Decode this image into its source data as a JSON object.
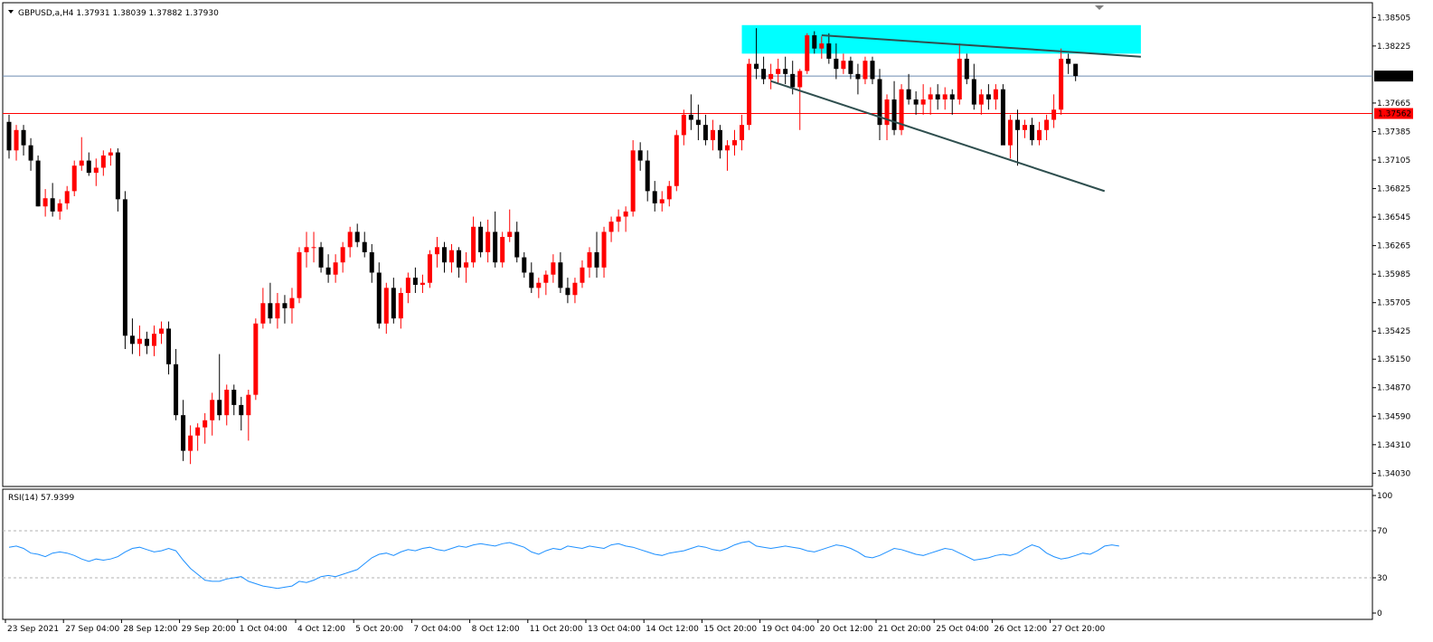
{
  "chart_data": [
    {
      "type": "candlestick",
      "symbol_header": "GBPUSD,a,H4  1.37931 1.38039 1.37882 1.37930",
      "ylim": [
        1.339,
        1.3865
      ],
      "y_ticks": [
        "1.38505",
        "1.38225",
        "1.37665",
        "1.37385",
        "1.37105",
        "1.36825",
        "1.36545",
        "1.36265",
        "1.35985",
        "1.35705",
        "1.35425",
        "1.35150",
        "1.34870",
        "1.34590",
        "1.34310",
        "1.34030"
      ],
      "y_tick_values": [
        1.38505,
        1.38225,
        1.37665,
        1.37385,
        1.37105,
        1.36825,
        1.36545,
        1.36265,
        1.35985,
        1.35705,
        1.35425,
        1.3515,
        1.3487,
        1.3459,
        1.3431,
        1.3403
      ],
      "x_ticks": [
        "23 Sep 2021",
        "27 Sep 04:00",
        "28 Sep 12:00",
        "29 Sep 20:00",
        "1 Oct 04:00",
        "4 Oct 12:00",
        "5 Oct 20:00",
        "7 Oct 04:00",
        "8 Oct 12:00",
        "11 Oct 20:00",
        "13 Oct 04:00",
        "14 Oct 12:00",
        "15 Oct 20:00",
        "19 Oct 04:00",
        "20 Oct 12:00",
        "21 Oct 20:00",
        "25 Oct 04:00",
        "26 Oct 12:00",
        "27 Oct 20:00"
      ],
      "x_tick_bar_index": [
        0,
        8,
        16,
        24,
        32,
        40,
        48,
        56,
        64,
        72,
        80,
        88,
        96,
        104,
        112,
        120,
        128,
        136,
        144
      ],
      "current_price": {
        "label": "1.37930",
        "value": 1.3793
      },
      "support_line": {
        "label": "1.37562",
        "value": 1.37562
      },
      "resistance_zone": {
        "from_bar": 101,
        "to_bar": 156,
        "low": 1.3815,
        "high": 1.3843
      },
      "trendlines": [
        {
          "from_bar": 112,
          "from_value": 1.3833,
          "to_bar": 156,
          "to_value": 1.3812
        },
        {
          "from_bar": 105,
          "from_value": 1.3788,
          "to_bar": 151,
          "to_value": 1.368
        }
      ],
      "candles": [
        [
          1.3748,
          1.3755,
          1.3712,
          1.372
        ],
        [
          1.372,
          1.3745,
          1.371,
          1.374
        ],
        [
          1.374,
          1.3745,
          1.3715,
          1.3725
        ],
        [
          1.3725,
          1.3732,
          1.37,
          1.371
        ],
        [
          1.371,
          1.3715,
          1.3665,
          1.3665
        ],
        [
          1.3665,
          1.3682,
          1.3655,
          1.3673
        ],
        [
          1.3673,
          1.3688,
          1.3655,
          1.366
        ],
        [
          1.366,
          1.3672,
          1.3652,
          1.3668
        ],
        [
          1.3668,
          1.3685,
          1.3662,
          1.368
        ],
        [
          1.368,
          1.371,
          1.3675,
          1.3705
        ],
        [
          1.3705,
          1.3733,
          1.37,
          1.371
        ],
        [
          1.371,
          1.3718,
          1.3695,
          1.3698
        ],
        [
          1.3698,
          1.3712,
          1.3685,
          1.3703
        ],
        [
          1.3703,
          1.372,
          1.3695,
          1.3715
        ],
        [
          1.3715,
          1.3722,
          1.3705,
          1.3718
        ],
        [
          1.3718,
          1.3722,
          1.366,
          1.3672
        ],
        [
          1.3672,
          1.368,
          1.3525,
          1.3538
        ],
        [
          1.3538,
          1.3555,
          1.352,
          1.353
        ],
        [
          1.353,
          1.3548,
          1.3518,
          1.3535
        ],
        [
          1.3535,
          1.3542,
          1.352,
          1.3528
        ],
        [
          1.3528,
          1.3548,
          1.3518,
          1.354
        ],
        [
          1.354,
          1.3552,
          1.353,
          1.3545
        ],
        [
          1.3545,
          1.3552,
          1.35,
          1.351
        ],
        [
          1.351,
          1.3525,
          1.3455,
          1.346
        ],
        [
          1.346,
          1.3475,
          1.3415,
          1.3425
        ],
        [
          1.3425,
          1.345,
          1.3412,
          1.344
        ],
        [
          1.344,
          1.3452,
          1.3425,
          1.3448
        ],
        [
          1.3448,
          1.3462,
          1.3432,
          1.3455
        ],
        [
          1.3455,
          1.3482,
          1.344,
          1.3475
        ],
        [
          1.3475,
          1.352,
          1.3455,
          1.346
        ],
        [
          1.346,
          1.349,
          1.345,
          1.3485
        ],
        [
          1.3485,
          1.349,
          1.346,
          1.347
        ],
        [
          1.347,
          1.3478,
          1.3445,
          1.346
        ],
        [
          1.346,
          1.3485,
          1.3435,
          1.348
        ],
        [
          1.348,
          1.3555,
          1.3475,
          1.355
        ],
        [
          1.355,
          1.3585,
          1.3545,
          1.357
        ],
        [
          1.357,
          1.359,
          1.355,
          1.3555
        ],
        [
          1.3555,
          1.358,
          1.3545,
          1.357
        ],
        [
          1.357,
          1.3578,
          1.355,
          1.3565
        ],
        [
          1.3565,
          1.3585,
          1.355,
          1.3575
        ],
        [
          1.3575,
          1.3625,
          1.357,
          1.362
        ],
        [
          1.362,
          1.364,
          1.3605,
          1.3625
        ],
        [
          1.3625,
          1.364,
          1.361,
          1.3625
        ],
        [
          1.3625,
          1.363,
          1.36,
          1.3605
        ],
        [
          1.3605,
          1.3618,
          1.359,
          1.3598
        ],
        [
          1.3598,
          1.3618,
          1.359,
          1.361
        ],
        [
          1.361,
          1.363,
          1.36,
          1.3625
        ],
        [
          1.3625,
          1.3645,
          1.3615,
          1.364
        ],
        [
          1.364,
          1.3648,
          1.3625,
          1.363
        ],
        [
          1.363,
          1.364,
          1.3615,
          1.362
        ],
        [
          1.362,
          1.3628,
          1.359,
          1.36
        ],
        [
          1.36,
          1.361,
          1.3545,
          1.355
        ],
        [
          1.355,
          1.359,
          1.354,
          1.3585
        ],
        [
          1.3585,
          1.3595,
          1.355,
          1.3555
        ],
        [
          1.3555,
          1.3585,
          1.3545,
          1.358
        ],
        [
          1.358,
          1.36,
          1.357,
          1.3595
        ],
        [
          1.3595,
          1.3605,
          1.358,
          1.3588
        ],
        [
          1.3588,
          1.3598,
          1.358,
          1.359
        ],
        [
          1.359,
          1.3622,
          1.3585,
          1.3618
        ],
        [
          1.3618,
          1.3635,
          1.3605,
          1.3625
        ],
        [
          1.3625,
          1.363,
          1.36,
          1.361
        ],
        [
          1.361,
          1.3628,
          1.36,
          1.3622
        ],
        [
          1.3622,
          1.3625,
          1.3595,
          1.3605
        ],
        [
          1.3605,
          1.362,
          1.359,
          1.361
        ],
        [
          1.361,
          1.3655,
          1.3605,
          1.3645
        ],
        [
          1.3645,
          1.365,
          1.3615,
          1.362
        ],
        [
          1.362,
          1.3652,
          1.361,
          1.364
        ],
        [
          1.364,
          1.366,
          1.3605,
          1.361
        ],
        [
          1.361,
          1.364,
          1.3605,
          1.3635
        ],
        [
          1.3635,
          1.3662,
          1.363,
          1.364
        ],
        [
          1.364,
          1.365,
          1.361,
          1.3615
        ],
        [
          1.3615,
          1.362,
          1.3595,
          1.36
        ],
        [
          1.36,
          1.361,
          1.358,
          1.3585
        ],
        [
          1.3585,
          1.3595,
          1.3575,
          1.359
        ],
        [
          1.359,
          1.3602,
          1.3578,
          1.3598
        ],
        [
          1.3598,
          1.3618,
          1.359,
          1.361
        ],
        [
          1.361,
          1.362,
          1.358,
          1.3585
        ],
        [
          1.3585,
          1.3595,
          1.357,
          1.3578
        ],
        [
          1.3578,
          1.3595,
          1.357,
          1.359
        ],
        [
          1.359,
          1.3612,
          1.3585,
          1.3605
        ],
        [
          1.3605,
          1.3625,
          1.3595,
          1.362
        ],
        [
          1.362,
          1.364,
          1.3595,
          1.3605
        ],
        [
          1.3605,
          1.3645,
          1.3595,
          1.364
        ],
        [
          1.364,
          1.3655,
          1.363,
          1.365
        ],
        [
          1.365,
          1.3662,
          1.364,
          1.3655
        ],
        [
          1.3655,
          1.3665,
          1.364,
          1.366
        ],
        [
          1.366,
          1.373,
          1.3655,
          1.372
        ],
        [
          1.372,
          1.3728,
          1.37,
          1.371
        ],
        [
          1.371,
          1.372,
          1.367,
          1.368
        ],
        [
          1.368,
          1.369,
          1.366,
          1.3668
        ],
        [
          1.3668,
          1.368,
          1.366,
          1.3672
        ],
        [
          1.3672,
          1.369,
          1.3665,
          1.3685
        ],
        [
          1.3685,
          1.374,
          1.368,
          1.3735
        ],
        [
          1.3735,
          1.376,
          1.3725,
          1.3755
        ],
        [
          1.3755,
          1.3775,
          1.374,
          1.375
        ],
        [
          1.375,
          1.3765,
          1.373,
          1.3745
        ],
        [
          1.3745,
          1.3755,
          1.3725,
          1.373
        ],
        [
          1.373,
          1.375,
          1.372,
          1.374
        ],
        [
          1.374,
          1.3745,
          1.3712,
          1.372
        ],
        [
          1.372,
          1.373,
          1.37,
          1.3725
        ],
        [
          1.3725,
          1.374,
          1.3715,
          1.373
        ],
        [
          1.373,
          1.3755,
          1.372,
          1.3745
        ],
        [
          1.3745,
          1.381,
          1.374,
          1.3805
        ],
        [
          1.3805,
          1.384,
          1.379,
          1.38
        ],
        [
          1.38,
          1.3812,
          1.3785,
          1.379
        ],
        [
          1.379,
          1.3805,
          1.378,
          1.3795
        ],
        [
          1.3795,
          1.381,
          1.3785,
          1.38
        ],
        [
          1.38,
          1.3812,
          1.3785,
          1.3795
        ],
        [
          1.3795,
          1.3808,
          1.3775,
          1.3782
        ],
        [
          1.3782,
          1.38,
          1.374,
          1.3798
        ],
        [
          1.3798,
          1.3835,
          1.3795,
          1.3833
        ],
        [
          1.3833,
          1.3837,
          1.3815,
          1.382
        ],
        [
          1.382,
          1.3832,
          1.381,
          1.3825
        ],
        [
          1.3825,
          1.3835,
          1.3805,
          1.381
        ],
        [
          1.381,
          1.3825,
          1.379,
          1.38
        ],
        [
          1.38,
          1.3815,
          1.3795,
          1.3808
        ],
        [
          1.3808,
          1.3812,
          1.379,
          1.3795
        ],
        [
          1.3795,
          1.3805,
          1.3775,
          1.379
        ],
        [
          1.379,
          1.3812,
          1.3785,
          1.3808
        ],
        [
          1.3808,
          1.3812,
          1.3785,
          1.379
        ],
        [
          1.379,
          1.38,
          1.373,
          1.3745
        ],
        [
          1.3745,
          1.3775,
          1.373,
          1.377
        ],
        [
          1.377,
          1.3788,
          1.3735,
          1.374
        ],
        [
          1.374,
          1.3785,
          1.3735,
          1.378
        ],
        [
          1.378,
          1.3795,
          1.3765,
          1.377
        ],
        [
          1.377,
          1.3778,
          1.3755,
          1.3765
        ],
        [
          1.3765,
          1.3785,
          1.3755,
          1.377
        ],
        [
          1.377,
          1.3782,
          1.3755,
          1.3775
        ],
        [
          1.3775,
          1.3785,
          1.376,
          1.377
        ],
        [
          1.377,
          1.3782,
          1.376,
          1.3775
        ],
        [
          1.3775,
          1.378,
          1.3755,
          1.377
        ],
        [
          1.377,
          1.3825,
          1.3765,
          1.381
        ],
        [
          1.381,
          1.3815,
          1.3785,
          1.379
        ],
        [
          1.379,
          1.3805,
          1.376,
          1.3765
        ],
        [
          1.3765,
          1.378,
          1.3755,
          1.3775
        ],
        [
          1.3775,
          1.3785,
          1.376,
          1.377
        ],
        [
          1.377,
          1.3785,
          1.376,
          1.378
        ],
        [
          1.378,
          1.3785,
          1.376,
          1.3725
        ],
        [
          1.3725,
          1.3755,
          1.3712,
          1.375
        ],
        [
          1.375,
          1.376,
          1.3705,
          1.374
        ],
        [
          1.374,
          1.375,
          1.3732,
          1.3745
        ],
        [
          1.3745,
          1.3752,
          1.3725,
          1.373
        ],
        [
          1.373,
          1.3748,
          1.3725,
          1.374
        ],
        [
          1.374,
          1.3755,
          1.373,
          1.375
        ],
        [
          1.375,
          1.3775,
          1.3742,
          1.376
        ],
        [
          1.376,
          1.382,
          1.3755,
          1.381
        ],
        [
          1.381,
          1.3815,
          1.3795,
          1.3805
        ],
        [
          1.3805,
          1.3805,
          1.3788,
          1.3793
        ]
      ],
      "colors": {
        "up": "#ff0000",
        "down": "#000000",
        "background": "#ffffff",
        "current_line": "#6e8bb0",
        "support": "#ff0000",
        "zone": "#00ffff",
        "trendline": "#2f4f4f"
      }
    },
    {
      "type": "line",
      "label": "RSI(14) 57.9399",
      "ylim": [
        0,
        100
      ],
      "y_ticks": [
        "100",
        "70",
        "30",
        "0"
      ],
      "y_tick_values": [
        100,
        70,
        30,
        0
      ],
      "levels": [
        70,
        30
      ],
      "series": [
        {
          "values": [
            56,
            57,
            55,
            51,
            50,
            48,
            51,
            52,
            51,
            49,
            46,
            44,
            46,
            45,
            46,
            48,
            52,
            55,
            56,
            54,
            52,
            53,
            55,
            53,
            45,
            38,
            33,
            28,
            27,
            27,
            29,
            30,
            31,
            27,
            25,
            23,
            22,
            21,
            22,
            23,
            27,
            26,
            28,
            31,
            32,
            31,
            33,
            35,
            37,
            42,
            47,
            50,
            51,
            49,
            52,
            54,
            53,
            55,
            56,
            54,
            53,
            55,
            57,
            56,
            58,
            59,
            58,
            57,
            59,
            60,
            58,
            56,
            52,
            50,
            53,
            55,
            54,
            57,
            56,
            55,
            57,
            56,
            55,
            58,
            59,
            57,
            56,
            54,
            52,
            50,
            49,
            51,
            52,
            53,
            55,
            57,
            56,
            54,
            53,
            55,
            58,
            60,
            61,
            57,
            56,
            55,
            56,
            57,
            56,
            55,
            53,
            52,
            54,
            56,
            58,
            57,
            55,
            52,
            48,
            47,
            49,
            52,
            55,
            54,
            52,
            50,
            49,
            51,
            53,
            55,
            54,
            51,
            48,
            45,
            46,
            47,
            49,
            50,
            49,
            51,
            55,
            58,
            56,
            51,
            48,
            46,
            47,
            49,
            51,
            50,
            53,
            57,
            58,
            57
          ]
        }
      ],
      "colors": {
        "line": "#1e90ff",
        "levels": "#b0b0b0"
      }
    }
  ]
}
